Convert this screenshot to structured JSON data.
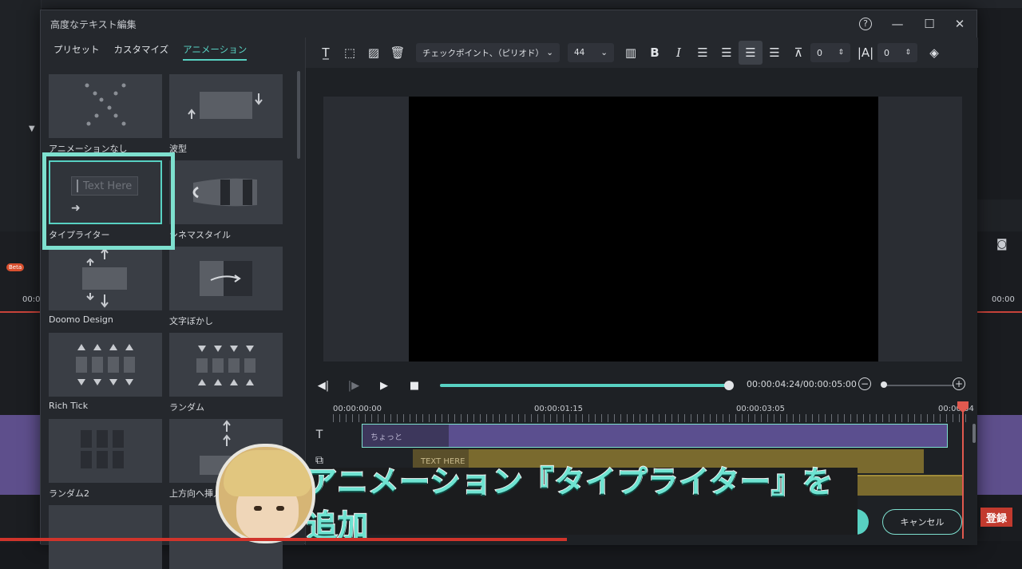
{
  "dialog": {
    "title": "高度なテキスト編集",
    "controls": {
      "help": "?",
      "minimize": "—",
      "maximize": "☐",
      "close": "✕"
    }
  },
  "tabs": [
    {
      "label": "プリセット"
    },
    {
      "label": "カスタマイズ"
    },
    {
      "label": "アニメーション",
      "active": true
    }
  ],
  "animations": [
    {
      "label": "アニメーションなし"
    },
    {
      "label": "波型"
    },
    {
      "label": "タイプライター",
      "selected": true,
      "preview_text": "Text Here"
    },
    {
      "label": "シネマスタイル"
    },
    {
      "label": "Doomo Design"
    },
    {
      "label": "文字ぼかし"
    },
    {
      "label": "Rich Tick"
    },
    {
      "label": "ランダム"
    },
    {
      "label": "ランダム2"
    },
    {
      "label": "上方向へ挿入"
    }
  ],
  "toolbar": {
    "font": "チェックポイント、（ピリオド）",
    "size": "44",
    "char_spacing": "0",
    "line_spacing": "0"
  },
  "player": {
    "timecode": "00:00:04:24/00:00:05:00",
    "progress": 0.99
  },
  "ruler": {
    "t0": "00:00:00:00",
    "t1": "00:00:01:15",
    "t2": "00:00:03:05",
    "t3": "00:00:04"
  },
  "tracks": {
    "text_clip_label": "ちょっと",
    "title_clip_label": "TEXT HERE"
  },
  "buttons": {
    "cancel": "キャンセル"
  },
  "overlay": {
    "banner": "アニメーション『タイプライター』を追加",
    "register": "登録"
  },
  "background": {
    "beta": "Beta",
    "left_time": "00:0",
    "right_time": "00:00"
  },
  "colors": {
    "accent": "#58d1c2",
    "text_clip": "#5b4f8f",
    "title_clip": "#7a6a2e",
    "playhead": "#e0594f"
  }
}
